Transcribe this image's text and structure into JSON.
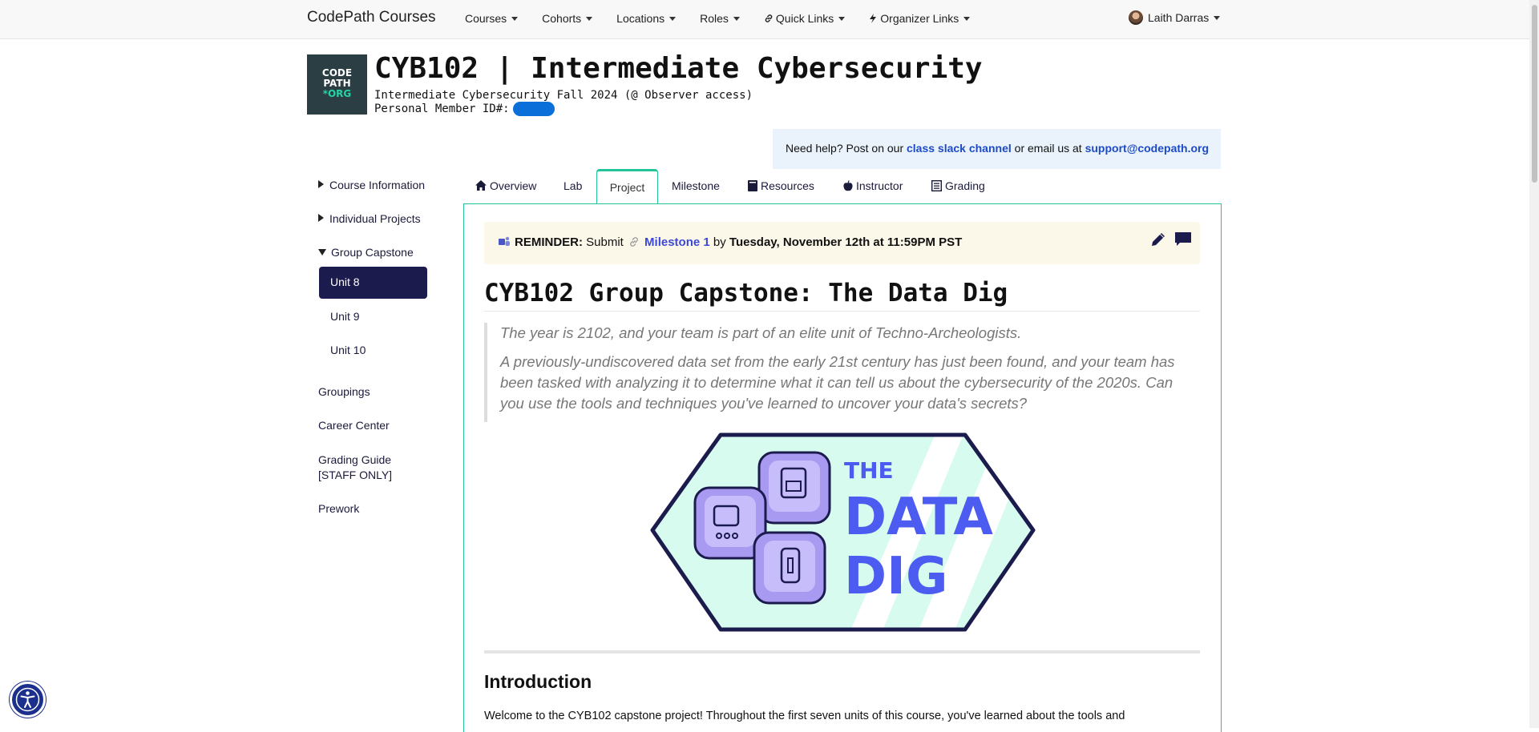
{
  "topbar": {
    "brand": "CodePath Courses",
    "nav": [
      {
        "label": "Courses",
        "icon": ""
      },
      {
        "label": "Cohorts",
        "icon": ""
      },
      {
        "label": "Locations",
        "icon": ""
      },
      {
        "label": "Roles",
        "icon": ""
      },
      {
        "label": "Quick Links",
        "icon": "link-icon"
      },
      {
        "label": "Organizer Links",
        "icon": "bolt-icon"
      }
    ],
    "user_name": "Laith Darras"
  },
  "header": {
    "logo_line1": "CODE",
    "logo_line2": "PATH",
    "logo_line3": "*ORG",
    "title": "CYB102 | Intermediate Cybersecurity",
    "subtitle": "Intermediate Cybersecurity Fall 2024 (@ Observer access)",
    "member_label": "Personal Member ID#:"
  },
  "help": {
    "prefix": "Need help? Post on our ",
    "slack_link": "class slack channel",
    "middle": " or email us at ",
    "email_link": "support@codepath.org"
  },
  "sidebar": {
    "course_information": "Course Information",
    "individual_projects": "Individual Projects",
    "group_capstone": "Group Capstone",
    "units": [
      "Unit 8",
      "Unit 9",
      "Unit 10"
    ],
    "groupings": "Groupings",
    "career_center": "Career Center",
    "grading_guide_1": "Grading Guide",
    "grading_guide_2": "[STAFF ONLY]",
    "prework": "Prework"
  },
  "tabs": {
    "overview": "Overview",
    "lab": "Lab",
    "project": "Project",
    "milestone": "Milestone",
    "resources": "Resources",
    "instructor": "Instructor",
    "grading": "Grading"
  },
  "reminder": {
    "label": "REMINDER:",
    "submit": " Submit ",
    "link": "Milestone 1",
    "by": " by ",
    "deadline": "Tuesday, November 12th at 11:59PM PST"
  },
  "page": {
    "title": "CYB102 Group Capstone: The Data Dig",
    "quote_1": "The year is 2102, and your team is part of an elite unit of Techno-Archeologists.",
    "quote_2": "A previously-undiscovered data set from the early 21st century has just been found, and your team has been tasked with analyzing it to determine what it can tell us about the cybersecurity of the 2020s. Can you use the tools and techniques you've learned to uncover your data's secrets?",
    "art_line1": "THE",
    "art_line2": "DATA",
    "art_line3": "DIG",
    "intro_heading": "Introduction",
    "intro_text": "Welcome to the CYB102 capstone project! Throughout the first seven units of this course, you've learned about the tools and"
  },
  "colors": {
    "accent_green": "#24c39a",
    "nav_dark": "#1c1b4e",
    "link_blue": "#3c48d6",
    "reminder_bg": "#fcf8e9",
    "help_bg": "#eaf3fb"
  }
}
